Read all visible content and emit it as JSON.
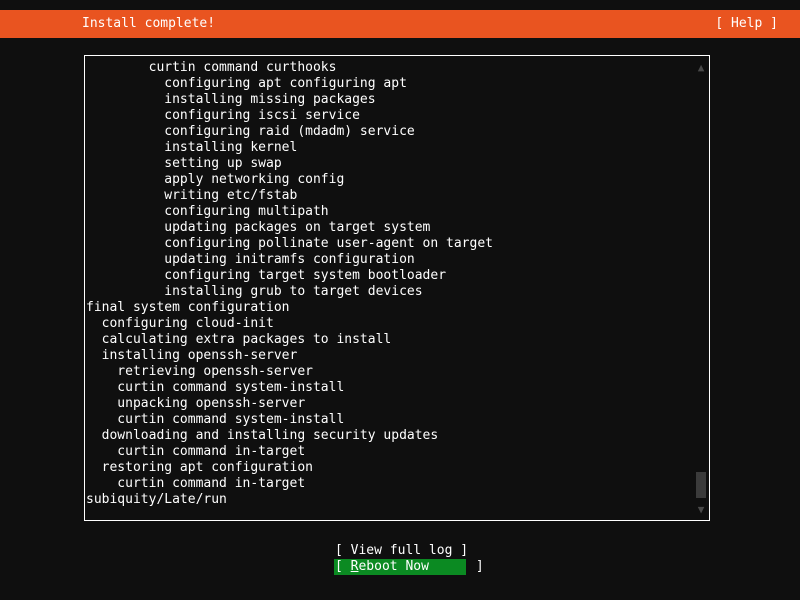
{
  "app": {
    "name": "subiquity-installer",
    "background_color": "#0f0f0f",
    "accent_color": "#e95420",
    "selection_color": "#0b8a22",
    "text_color": "#ffffff",
    "scrollbar_color": "#3b3b3b"
  },
  "header": {
    "title": "Install complete!",
    "help_label": "[ Help ]"
  },
  "log": {
    "lines": [
      "        curtin command curthooks",
      "          configuring apt configuring apt",
      "          installing missing packages",
      "          configuring iscsi service",
      "          configuring raid (mdadm) service",
      "          installing kernel",
      "          setting up swap",
      "          apply networking config",
      "          writing etc/fstab",
      "          configuring multipath",
      "          updating packages on target system",
      "          configuring pollinate user-agent on target",
      "          updating initramfs configuration",
      "          configuring target system bootloader",
      "          installing grub to target devices",
      "final system configuration",
      "  configuring cloud-init",
      "  calculating extra packages to install",
      "  installing openssh-server",
      "    retrieving openssh-server",
      "    curtin command system-install",
      "    unpacking openssh-server",
      "    curtin command system-install",
      "  downloading and installing security updates",
      "    curtin command in-target",
      "  restoring apt configuration",
      "    curtin command in-target",
      "subiquity/Late/run"
    ],
    "scrollbar": {
      "up_arrow": "▲",
      "down_arrow": "▼",
      "thumb_position": "near-bottom"
    }
  },
  "buttons": [
    {
      "id": "view-full-log",
      "prefix": "[ ",
      "text": "View full log",
      "accel": "",
      "rest": "",
      "suffix": " ]",
      "selected": false
    },
    {
      "id": "reboot-now",
      "prefix": "[ ",
      "text": "",
      "accel": "R",
      "rest": "eboot Now",
      "suffix": "      ]",
      "selected": true
    }
  ]
}
